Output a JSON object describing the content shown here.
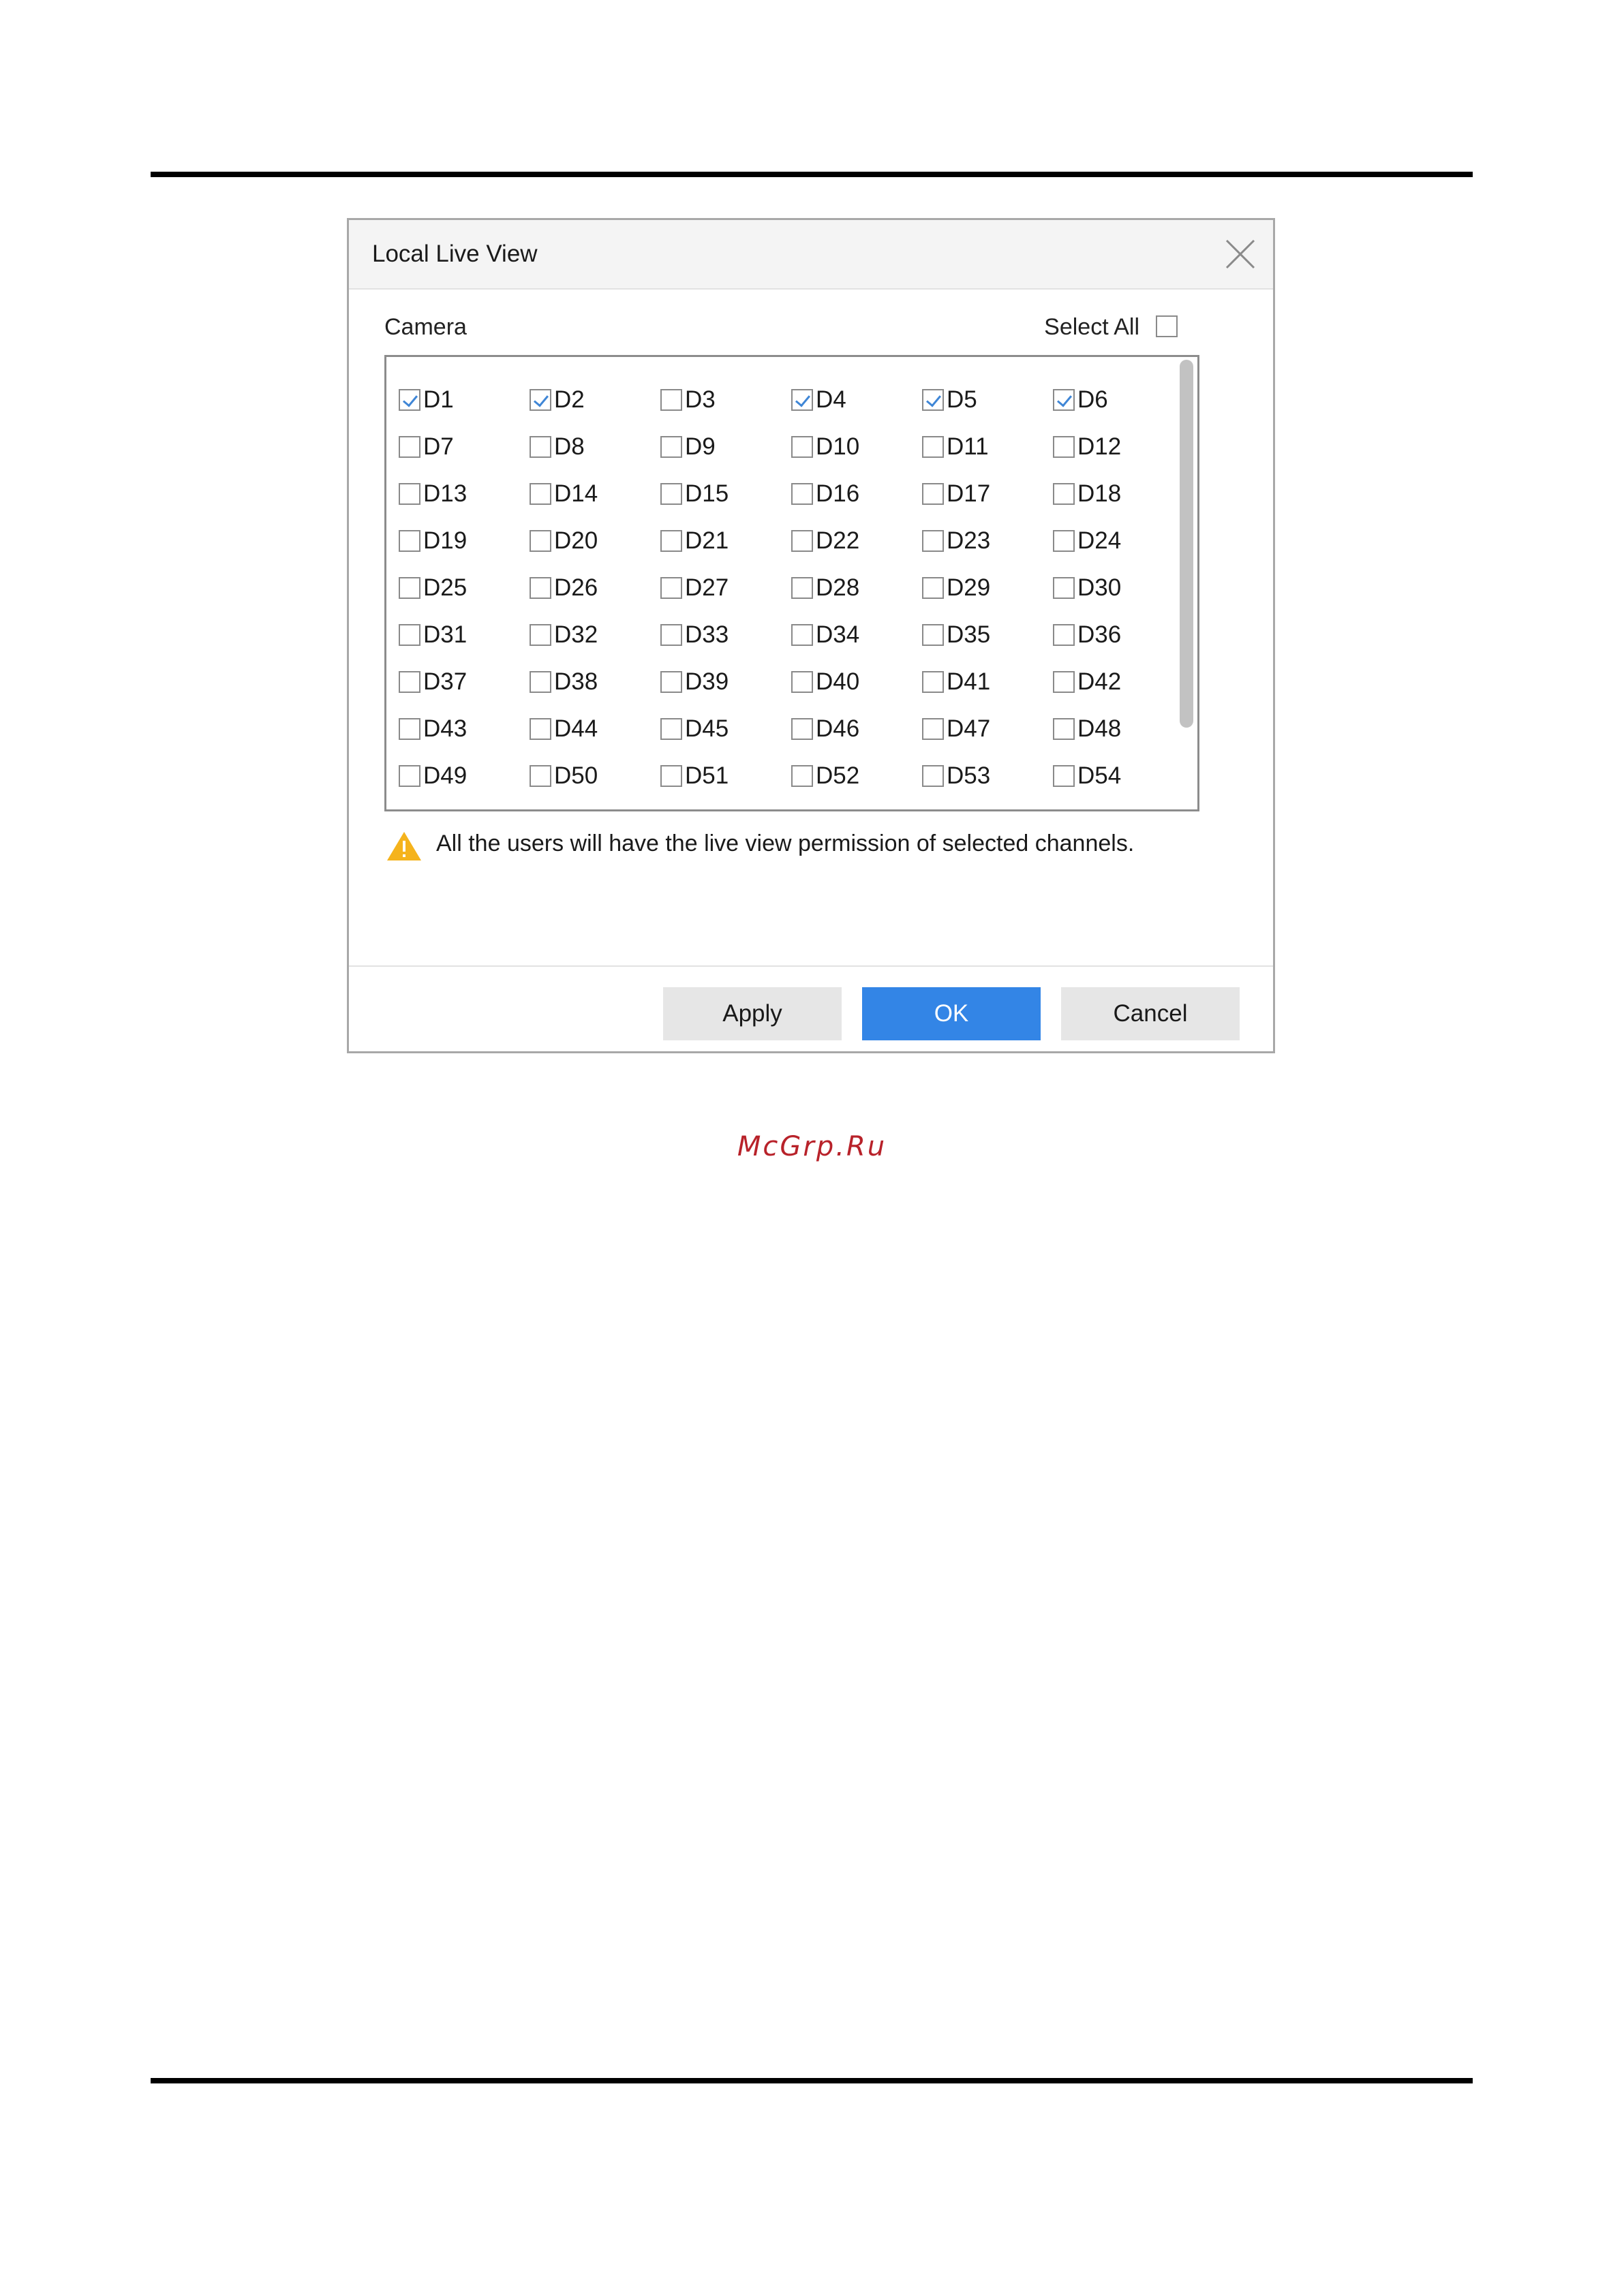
{
  "dialog": {
    "title": "Local Live View",
    "camera_label": "Camera",
    "select_all_label": "Select All",
    "select_all_checked": false,
    "channels": [
      {
        "label": "D1",
        "checked": true
      },
      {
        "label": "D2",
        "checked": true
      },
      {
        "label": "D3",
        "checked": false
      },
      {
        "label": "D4",
        "checked": true
      },
      {
        "label": "D5",
        "checked": true
      },
      {
        "label": "D6",
        "checked": true
      },
      {
        "label": "D7",
        "checked": false
      },
      {
        "label": "D8",
        "checked": false
      },
      {
        "label": "D9",
        "checked": false
      },
      {
        "label": "D10",
        "checked": false
      },
      {
        "label": "D11",
        "checked": false
      },
      {
        "label": "D12",
        "checked": false
      },
      {
        "label": "D13",
        "checked": false
      },
      {
        "label": "D14",
        "checked": false
      },
      {
        "label": "D15",
        "checked": false
      },
      {
        "label": "D16",
        "checked": false
      },
      {
        "label": "D17",
        "checked": false
      },
      {
        "label": "D18",
        "checked": false
      },
      {
        "label": "D19",
        "checked": false
      },
      {
        "label": "D20",
        "checked": false
      },
      {
        "label": "D21",
        "checked": false
      },
      {
        "label": "D22",
        "checked": false
      },
      {
        "label": "D23",
        "checked": false
      },
      {
        "label": "D24",
        "checked": false
      },
      {
        "label": "D25",
        "checked": false
      },
      {
        "label": "D26",
        "checked": false
      },
      {
        "label": "D27",
        "checked": false
      },
      {
        "label": "D28",
        "checked": false
      },
      {
        "label": "D29",
        "checked": false
      },
      {
        "label": "D30",
        "checked": false
      },
      {
        "label": "D31",
        "checked": false
      },
      {
        "label": "D32",
        "checked": false
      },
      {
        "label": "D33",
        "checked": false
      },
      {
        "label": "D34",
        "checked": false
      },
      {
        "label": "D35",
        "checked": false
      },
      {
        "label": "D36",
        "checked": false
      },
      {
        "label": "D37",
        "checked": false
      },
      {
        "label": "D38",
        "checked": false
      },
      {
        "label": "D39",
        "checked": false
      },
      {
        "label": "D40",
        "checked": false
      },
      {
        "label": "D41",
        "checked": false
      },
      {
        "label": "D42",
        "checked": false
      },
      {
        "label": "D43",
        "checked": false
      },
      {
        "label": "D44",
        "checked": false
      },
      {
        "label": "D45",
        "checked": false
      },
      {
        "label": "D46",
        "checked": false
      },
      {
        "label": "D47",
        "checked": false
      },
      {
        "label": "D48",
        "checked": false
      },
      {
        "label": "D49",
        "checked": false
      },
      {
        "label": "D50",
        "checked": false
      },
      {
        "label": "D51",
        "checked": false
      },
      {
        "label": "D52",
        "checked": false
      },
      {
        "label": "D53",
        "checked": false
      },
      {
        "label": "D54",
        "checked": false
      }
    ],
    "notice": "All the users will have the live view permission of selected channels.",
    "buttons": {
      "apply": "Apply",
      "ok": "OK",
      "cancel": "Cancel"
    },
    "icons": {
      "close": "close-icon",
      "warning": "warning-icon",
      "check": "checkmark"
    }
  },
  "watermark": "McGrp.Ru",
  "colors": {
    "accent": "#3385e6",
    "check": "#3f86d6",
    "warning": "#f5b31c",
    "watermark": "#b8222a"
  }
}
